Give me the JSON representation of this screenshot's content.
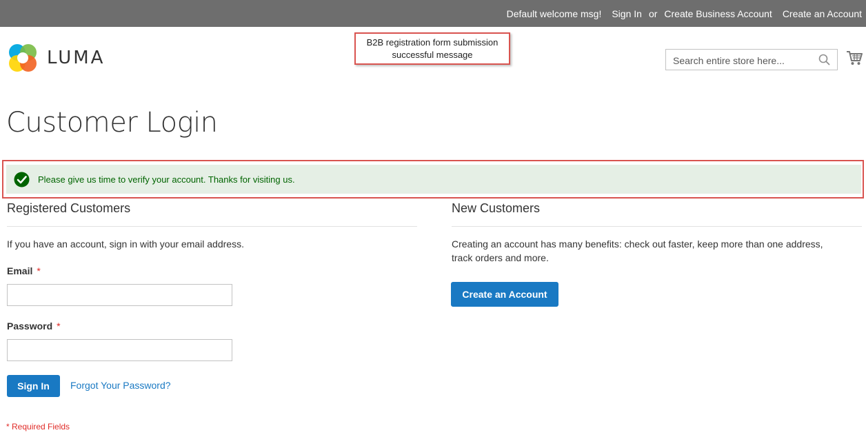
{
  "top_bar": {
    "welcome": "Default welcome msg!",
    "sign_in": "Sign In",
    "or": "or",
    "create_business": "Create Business Account",
    "create_account": "Create an Account"
  },
  "header": {
    "logo_text": "LUMA",
    "search_placeholder": "Search entire store here..."
  },
  "annotation": {
    "line1": "B2B registration form submission",
    "line2": "successful message"
  },
  "page_title": "Customer Login",
  "message": {
    "text": "Please give us time to verify your account. Thanks for visiting us."
  },
  "registered": {
    "title": "Registered Customers",
    "intro": "If you have an account, sign in with your email address.",
    "email_label": "Email",
    "password_label": "Password",
    "required_mark": "*",
    "sign_in_button": "Sign In",
    "forgot_link": "Forgot Your Password?",
    "required_note": "* Required Fields"
  },
  "new_customers": {
    "title": "New Customers",
    "intro_line1": "Creating an account has many benefits: check out faster, keep more than one address,",
    "intro_line2": "track orders and more.",
    "create_button": "Create an Account"
  },
  "colors": {
    "top_bar": "#6e6e6e",
    "accent_blue": "#1979c3",
    "success_bg": "#e5efe5",
    "success_text": "#006400",
    "annotation_border": "#d9534f",
    "required_red": "#e02b27"
  }
}
